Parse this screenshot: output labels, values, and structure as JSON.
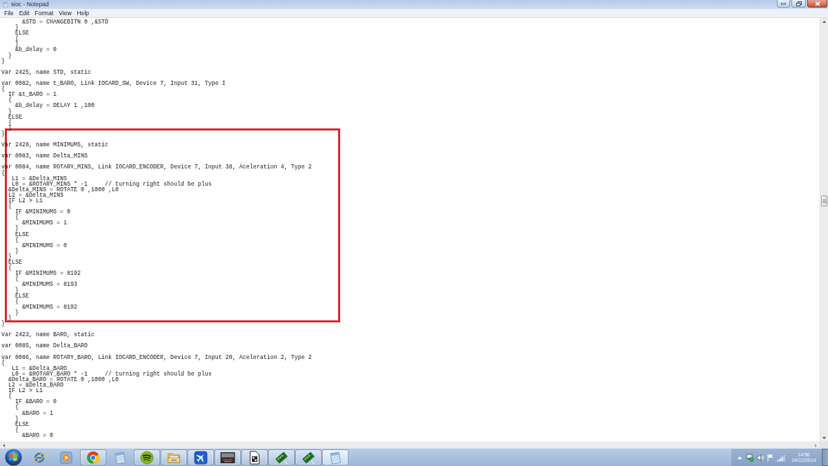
{
  "window": {
    "title": "sioc - Notepad"
  },
  "menu": [
    "File",
    "Edit",
    "Format",
    "View",
    "Help"
  ],
  "editor": {
    "sections": [
      {
        "highlighted": false,
        "lines": [
          {
            "kind": "code",
            "text": "      &STD = CHANGEBITN 0 ,&STD"
          },
          {
            "kind": "code",
            "text": "    }"
          },
          {
            "kind": "code",
            "text": "    ELSE"
          },
          {
            "kind": "code",
            "text": "    {"
          },
          {
            "kind": "code",
            "text": "    }"
          },
          {
            "kind": "code",
            "text": "    &b_delay = 0"
          },
          {
            "kind": "code",
            "text": "  }"
          },
          {
            "kind": "code",
            "text": "}"
          },
          {
            "kind": "blank"
          },
          {
            "kind": "code",
            "text": "Var 2425, name STD, static"
          },
          {
            "kind": "blank"
          },
          {
            "kind": "code",
            "text": "var 0082, name t_BARO, Link IOCARD_SW, Device 7, Input 31, Type I"
          },
          {
            "kind": "code",
            "text": "{"
          },
          {
            "kind": "code",
            "text": "  IF &t_BARO = 1"
          },
          {
            "kind": "code",
            "text": "  {"
          },
          {
            "kind": "code",
            "text": "    &b_delay = DELAY 1 ,100"
          },
          {
            "kind": "code",
            "text": "  }"
          },
          {
            "kind": "code",
            "text": "  ELSE"
          },
          {
            "kind": "code",
            "text": "  {"
          },
          {
            "kind": "code",
            "text": "  }"
          },
          {
            "kind": "code",
            "text": "}"
          },
          {
            "kind": "blank"
          }
        ]
      },
      {
        "highlighted": true,
        "lines": [
          {
            "kind": "code",
            "text": "Var 2428, name MINIMUMS, static"
          },
          {
            "kind": "blank"
          },
          {
            "kind": "code",
            "text": "var 0083, name Delta_MINS"
          },
          {
            "kind": "blank"
          },
          {
            "kind": "code",
            "text": "var 0084, name ROTARY_MINS, Link IOCARD_ENCODER, Device 7, Input 38, Aceleration 4, Type 2"
          },
          {
            "kind": "code",
            "text": "{"
          },
          {
            "kind": "code",
            "text": "   L1 = &Delta_MINS"
          },
          {
            "kind": "code",
            "text": "   L0 = &ROTARY_MINS * -1     // turning right should be plus"
          },
          {
            "kind": "code",
            "text": "  &Delta_MINS = ROTATE 0 ,1000 ,L0"
          },
          {
            "kind": "code",
            "text": "  L2 = &Delta_MINS"
          },
          {
            "kind": "code",
            "text": "  IF L2 > L1"
          },
          {
            "kind": "code",
            "text": "  {"
          },
          {
            "kind": "code",
            "text": "    IF &MINIMUMS = 0"
          },
          {
            "kind": "code",
            "text": "    {"
          },
          {
            "kind": "code",
            "text": "      &MINIMUMS = 1"
          },
          {
            "kind": "code",
            "text": "    }"
          },
          {
            "kind": "code",
            "text": "    ELSE"
          },
          {
            "kind": "code",
            "text": "    {"
          },
          {
            "kind": "code",
            "text": "      &MINIMUMS = 0"
          },
          {
            "kind": "code",
            "text": "    }"
          },
          {
            "kind": "code",
            "text": "  }"
          },
          {
            "kind": "code",
            "text": "  ELSE"
          },
          {
            "kind": "code",
            "text": "  {"
          },
          {
            "kind": "code",
            "text": "    IF &MINIMUMS = 8192"
          },
          {
            "kind": "code",
            "text": "    {"
          },
          {
            "kind": "code",
            "text": "      &MINIMUMS = 8193"
          },
          {
            "kind": "code",
            "text": "    }"
          },
          {
            "kind": "code",
            "text": "    ELSE"
          },
          {
            "kind": "code",
            "text": "    {"
          },
          {
            "kind": "code",
            "text": "      &MINIMUMS = 8192"
          },
          {
            "kind": "code",
            "text": "    }"
          },
          {
            "kind": "code",
            "text": "  }"
          }
        ]
      },
      {
        "highlighted": false,
        "lines": [
          {
            "kind": "code",
            "text": "}"
          },
          {
            "kind": "blank"
          },
          {
            "kind": "code",
            "text": "Var 2423, name BARO, static"
          },
          {
            "kind": "blank"
          },
          {
            "kind": "code",
            "text": "var 0085, name Delta_BARO"
          },
          {
            "kind": "blank"
          },
          {
            "kind": "code",
            "text": "var 0086, name ROTARY_BARO, Link IOCARD_ENCODER, Device 7, Input 20, Aceleration 2, Type 2"
          },
          {
            "kind": "code",
            "text": "{"
          },
          {
            "kind": "code",
            "text": "   L1 = &Delta_BARO"
          },
          {
            "kind": "code",
            "text": "   L0 = &ROTARY_BARO * -1     // turning right should be plus"
          },
          {
            "kind": "code",
            "text": "  &Delta_BARO = ROTATE 0 ,1000 ,L0"
          },
          {
            "kind": "code",
            "text": "  L2 = &Delta_BARO"
          },
          {
            "kind": "code",
            "text": "  IF L2 > L1"
          },
          {
            "kind": "code",
            "text": "  {"
          },
          {
            "kind": "code",
            "text": "    IF &BARO = 0"
          },
          {
            "kind": "code",
            "text": "    {"
          },
          {
            "kind": "code",
            "text": "      &BARO = 1"
          },
          {
            "kind": "code",
            "text": "    }"
          },
          {
            "kind": "code",
            "text": "    ELSE"
          },
          {
            "kind": "code",
            "text": "    {"
          },
          {
            "kind": "code",
            "text": "      &BARO = 0"
          }
        ]
      }
    ]
  },
  "taskbar": {
    "apps": [
      {
        "kind": "orbit",
        "running": false,
        "selected": false
      },
      {
        "kind": "player",
        "running": false,
        "selected": false
      },
      {
        "kind": "wheel",
        "running": true,
        "selected": false
      },
      {
        "kind": "notepad",
        "running": false,
        "selected": false
      },
      {
        "kind": "arcs",
        "running": true,
        "selected": false
      },
      {
        "kind": "folder",
        "running": true,
        "selected": false
      },
      {
        "kind": "plane",
        "running": true,
        "selected": false
      },
      {
        "kind": "thumbnail",
        "running": true,
        "selected": false
      },
      {
        "kind": "document",
        "running": true,
        "selected": false
      },
      {
        "kind": "board",
        "running": true,
        "selected": false
      },
      {
        "kind": "board",
        "running": true,
        "selected": false
      },
      {
        "kind": "notepad",
        "running": true,
        "selected": true
      }
    ],
    "clock": {
      "time": "14:56",
      "date": "24/12/2014"
    }
  }
}
